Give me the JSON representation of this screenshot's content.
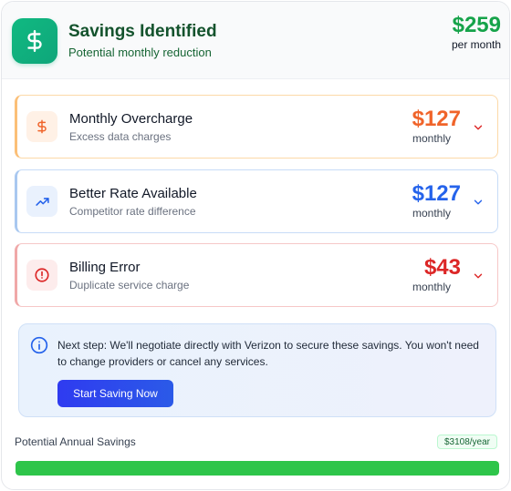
{
  "header": {
    "title": "Savings Identified",
    "subtitle": "Potential monthly reduction",
    "amount": "$259",
    "period": "per month",
    "icon": "dollar-icon"
  },
  "items": [
    {
      "title": "Monthly Overcharge",
      "description": "Excess data charges",
      "amount": "$127",
      "period": "monthly",
      "icon": "dollar-icon",
      "accent": "#f0642a"
    },
    {
      "title": "Better Rate Available",
      "description": "Competitor rate difference",
      "amount": "$127",
      "period": "monthly",
      "icon": "trending-up-icon",
      "accent": "#2563eb"
    },
    {
      "title": "Billing Error",
      "description": "Duplicate service charge",
      "amount": "$43",
      "period": "monthly",
      "icon": "alert-circle-icon",
      "accent": "#dc2626"
    }
  ],
  "next_step": {
    "text": "Next step: We'll negotiate directly with Verizon to secure these savings. You won't need to change providers or cancel any services.",
    "button_label": "Start Saving Now"
  },
  "annual": {
    "label": "Potential Annual Savings",
    "badge": "$3108/year",
    "progress_fraction": 1.0
  },
  "colors": {
    "brand_green": "#16a34a",
    "button_blue": "#2f3bf0",
    "progress_green": "#2ec54a"
  }
}
